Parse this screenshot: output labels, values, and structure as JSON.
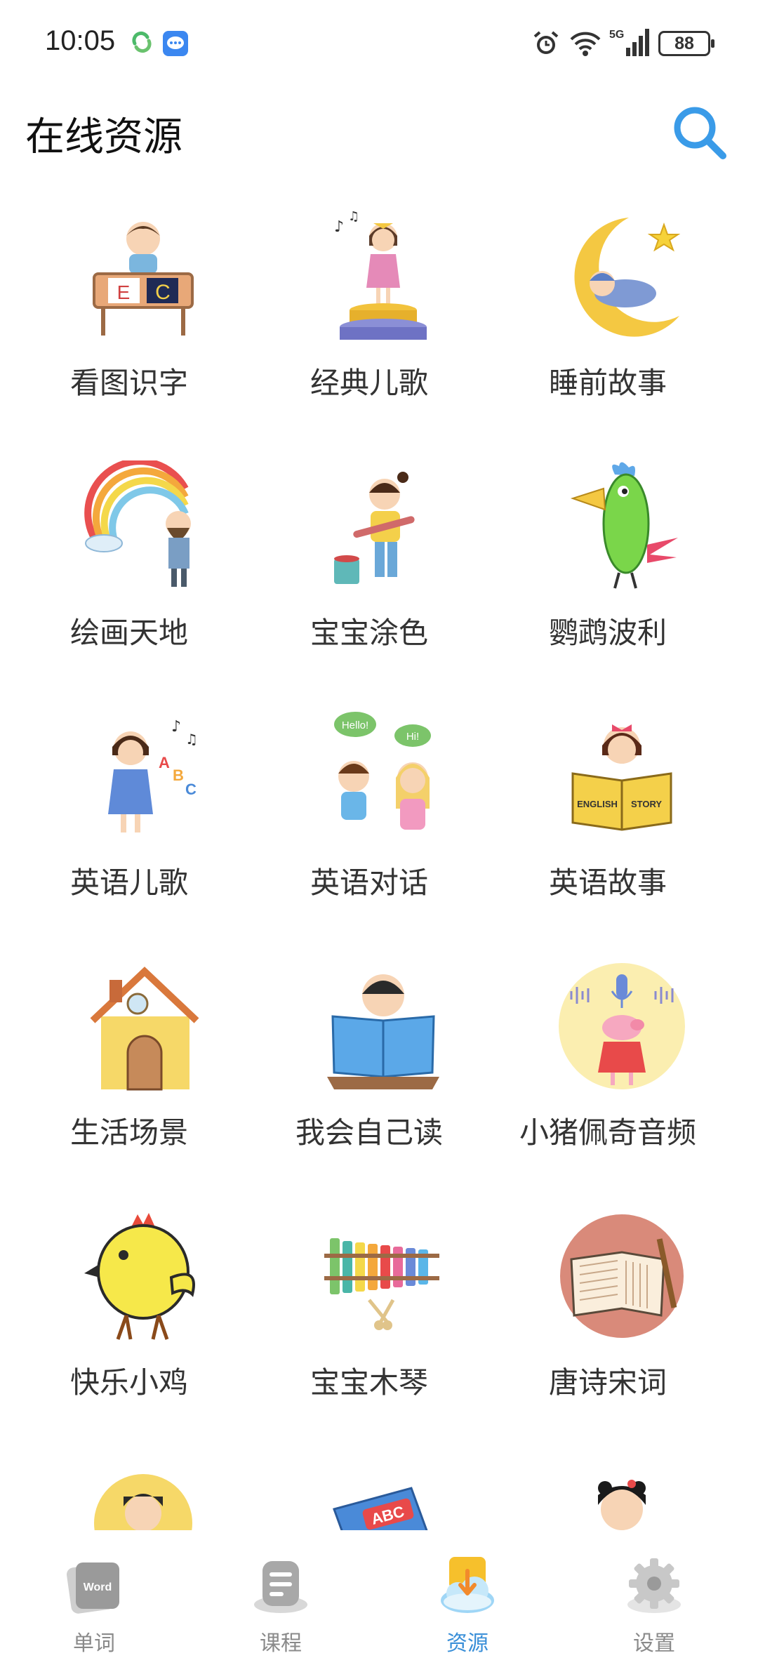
{
  "status": {
    "time": "10:05",
    "battery": "88",
    "network": "5G",
    "icons": [
      "sync-icon",
      "message-icon",
      "alarm-icon",
      "wifi-icon",
      "signal-icon",
      "battery-icon"
    ]
  },
  "header": {
    "title": "在线资源",
    "search_icon": "search-icon",
    "accent": "#3a9be8"
  },
  "grid": {
    "items": [
      {
        "label": "看图识字",
        "icon": "boy-at-desk-abc"
      },
      {
        "label": "经典儿歌",
        "icon": "girl-singing-on-stage"
      },
      {
        "label": "睡前故事",
        "icon": "baby-sleeping-on-moon"
      },
      {
        "label": "绘画天地",
        "icon": "painter-rainbow"
      },
      {
        "label": "宝宝涂色",
        "icon": "girl-painting"
      },
      {
        "label": "鹦鹉波利",
        "icon": "green-parrot"
      },
      {
        "label": "英语儿歌",
        "icon": "girl-singing-abc"
      },
      {
        "label": "英语对话",
        "icon": "kids-hello-hi"
      },
      {
        "label": "英语故事",
        "icon": "girl-english-story-book"
      },
      {
        "label": "生活场景",
        "icon": "yellow-house"
      },
      {
        "label": "我会自己读",
        "icon": "boy-reading-book"
      },
      {
        "label": "小猪佩奇音频",
        "icon": "peppa-pig-microphone"
      },
      {
        "label": "快乐小鸡",
        "icon": "yellow-chick"
      },
      {
        "label": "宝宝木琴",
        "icon": "xylophone"
      },
      {
        "label": "唐诗宋词",
        "icon": "ancient-book-brush"
      },
      {
        "label": "",
        "icon": "scholar-boy"
      },
      {
        "label": "",
        "icon": "abc-book"
      },
      {
        "label": "",
        "icon": "opera-girl"
      }
    ],
    "partial_illustration_texts": [
      "Hello!",
      "Hi!",
      "ENGLISH",
      "STORY",
      "ABC"
    ]
  },
  "bottom_nav": {
    "items": [
      {
        "label": "单词",
        "icon": "word-card-icon",
        "icon_text": "Word",
        "active": false
      },
      {
        "label": "课程",
        "icon": "course-icon",
        "active": false
      },
      {
        "label": "资源",
        "icon": "download-cloud-icon",
        "active": true
      },
      {
        "label": "设置",
        "icon": "gear-icon",
        "active": false
      }
    ],
    "active_color": "#3a8fd8"
  }
}
